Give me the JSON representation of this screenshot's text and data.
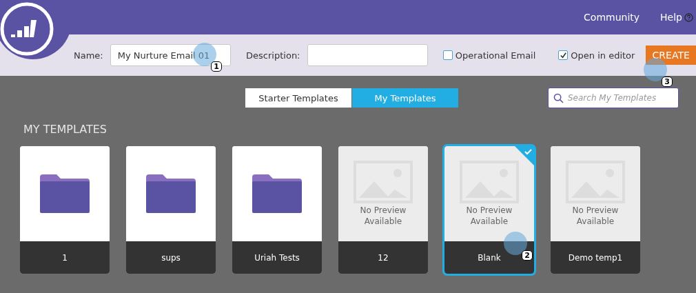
{
  "top_bar": {
    "links": [
      "Community",
      "Help"
    ]
  },
  "toolbar": {
    "name_label": "Name:",
    "name_value": "My Nurture Email 01",
    "name_callout": "1",
    "description_label": "Description:",
    "checkboxes": [
      {
        "label": "Operational Email",
        "checked": false
      },
      {
        "label": "Open in editor",
        "checked": true
      }
    ],
    "create_button": "CREATE",
    "create_callout": "3"
  },
  "tabs": [
    {
      "label": "Starter Templates",
      "selected": false
    },
    {
      "label": "My Templates",
      "selected": true
    }
  ],
  "search": {
    "placeholder": "Search My Templates"
  },
  "section_title": "MY TEMPLATES",
  "templates": [
    {
      "kind": "folder",
      "name": "1",
      "selected": false
    },
    {
      "kind": "folder",
      "name": "sups",
      "selected": false
    },
    {
      "kind": "folder",
      "name": "Uriah Tests",
      "selected": false
    },
    {
      "kind": "template",
      "name": "12",
      "preview": "No Preview Available",
      "selected": false
    },
    {
      "kind": "template",
      "name": "Blank",
      "preview": "No Preview Available",
      "selected": true,
      "callout": "2"
    },
    {
      "kind": "template",
      "name": "Demo temp1",
      "preview": "No Preview Available",
      "selected": false
    }
  ]
}
